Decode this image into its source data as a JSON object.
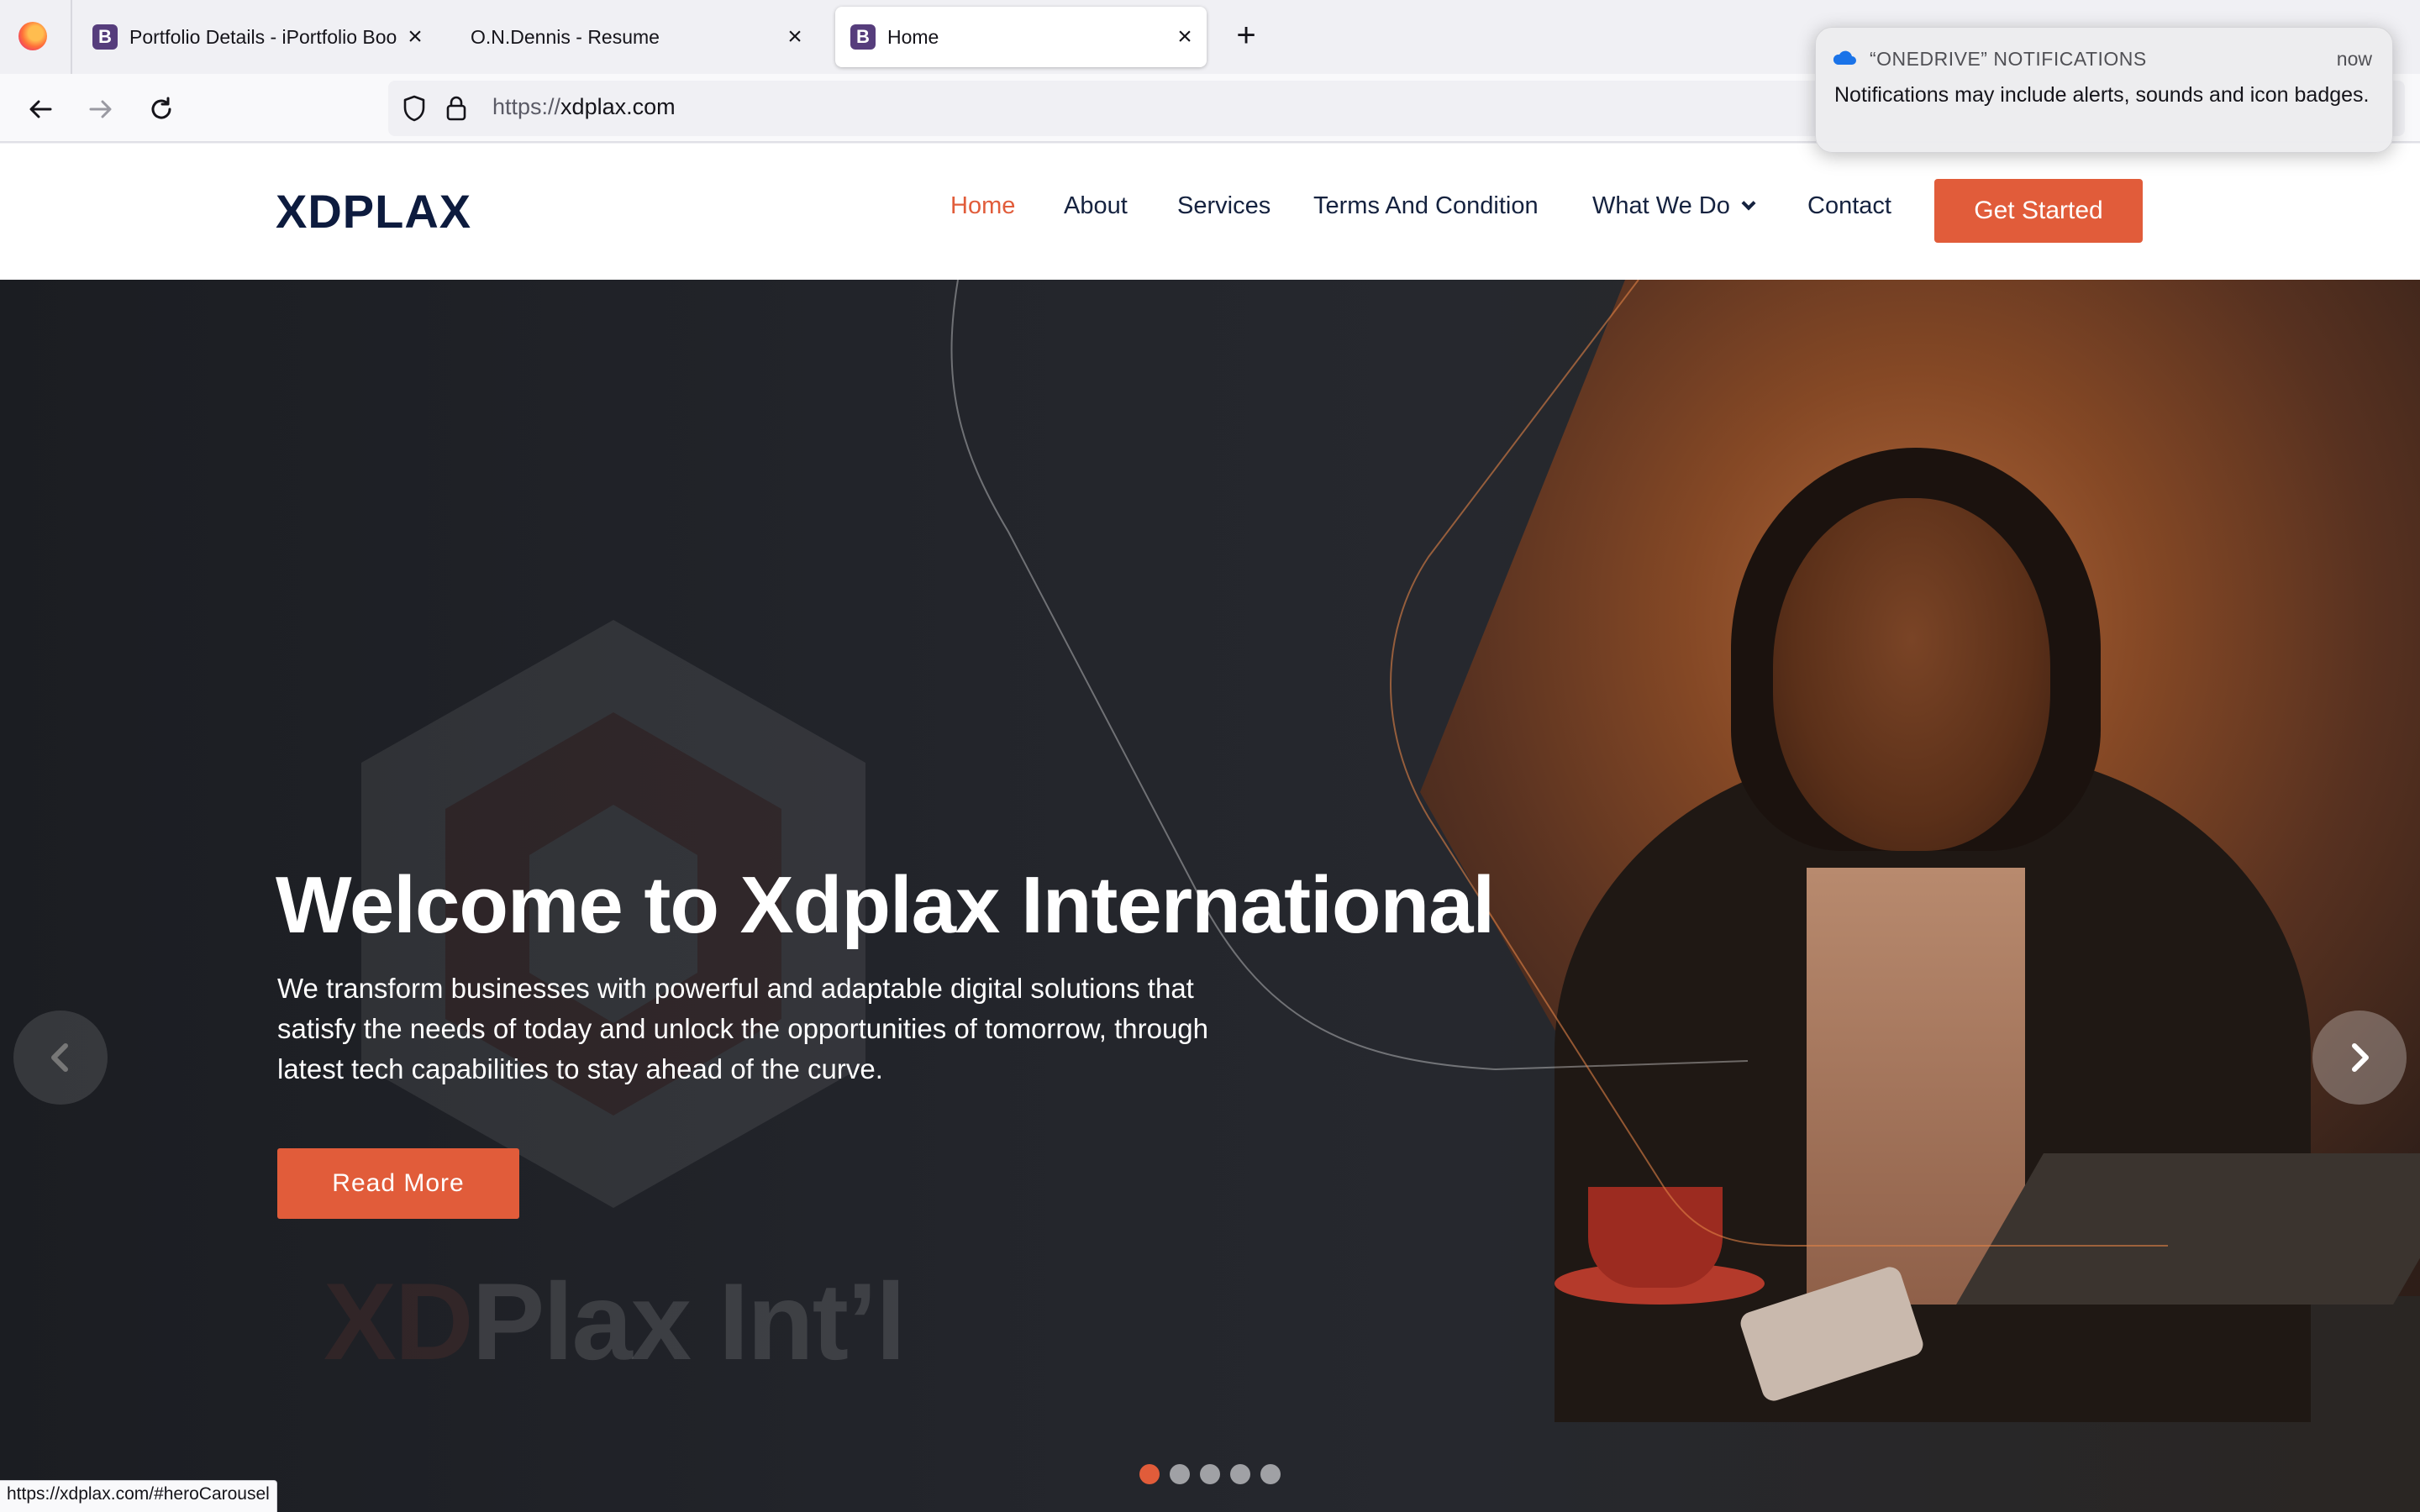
{
  "browser": {
    "tabs": [
      {
        "favicon": "B",
        "label": "Portfolio Details - iPortfolio Boo",
        "active": false
      },
      {
        "favicon": "",
        "label": "O.N.Dennis - Resume",
        "active": false
      },
      {
        "favicon": "B",
        "label": "Home",
        "active": true
      }
    ],
    "url_scheme": "https://",
    "url_host": "xdplax.com",
    "status_link": "https://xdplax.com/#heroCarousel"
  },
  "notification": {
    "app": "“ONEDRIVE” NOTIFICATIONS",
    "time": "now",
    "body": "Notifications may include alerts, sounds and icon badges."
  },
  "site": {
    "logo": "XDPLAX",
    "nav": [
      "Home",
      "About",
      "Services",
      "Terms And Condition",
      "What We Do",
      "Contact"
    ],
    "cta": "Get Started",
    "hero": {
      "title": "Welcome to Xdplax International",
      "description": "We transform businesses with powerful and adaptable digital solutions that satisfy the needs of today and unlock the opportunities of tomorrow, through latest tech capabilities to stay ahead of the curve.",
      "button": "Read More",
      "watermark_a": "XD",
      "watermark_b": "Plax Int’l",
      "slide_count": 5,
      "active_slide": 1
    }
  },
  "colors": {
    "accent": "#e15c3a",
    "navy": "#0d1b3e",
    "hero_bg": "#1f2126"
  }
}
